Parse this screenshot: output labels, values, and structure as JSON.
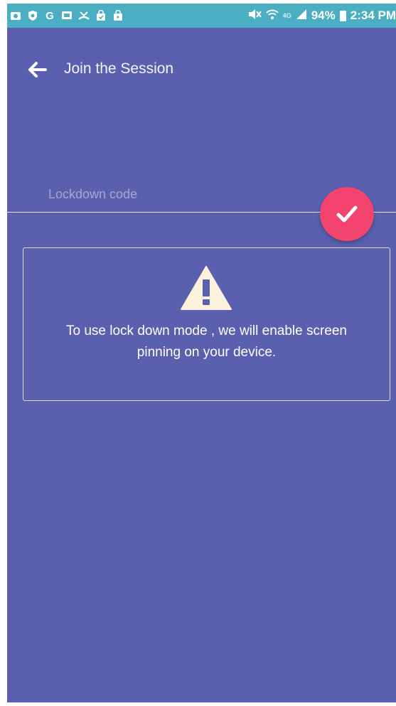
{
  "status_bar": {
    "left_icons": [
      "camera-icon",
      "shield-icon",
      "google-icon",
      "screenshot-icon",
      "missed-call-icon",
      "bag-icon",
      "bag-play-icon"
    ],
    "battery_percent": "94%",
    "time": "2:34 PM"
  },
  "toolbar": {
    "title": "Join the Session",
    "back_icon": "arrow-left-icon"
  },
  "form": {
    "code_placeholder": "Lockdown code",
    "code_value": "",
    "submit_icon": "check-icon",
    "accent_color": "#f2446f"
  },
  "notice": {
    "icon": "warning-icon",
    "message": "To use lock down mode , we will enable screen pinning on your device."
  },
  "colors": {
    "background": "#5a60ae",
    "status_bar": "#4bafc3"
  }
}
